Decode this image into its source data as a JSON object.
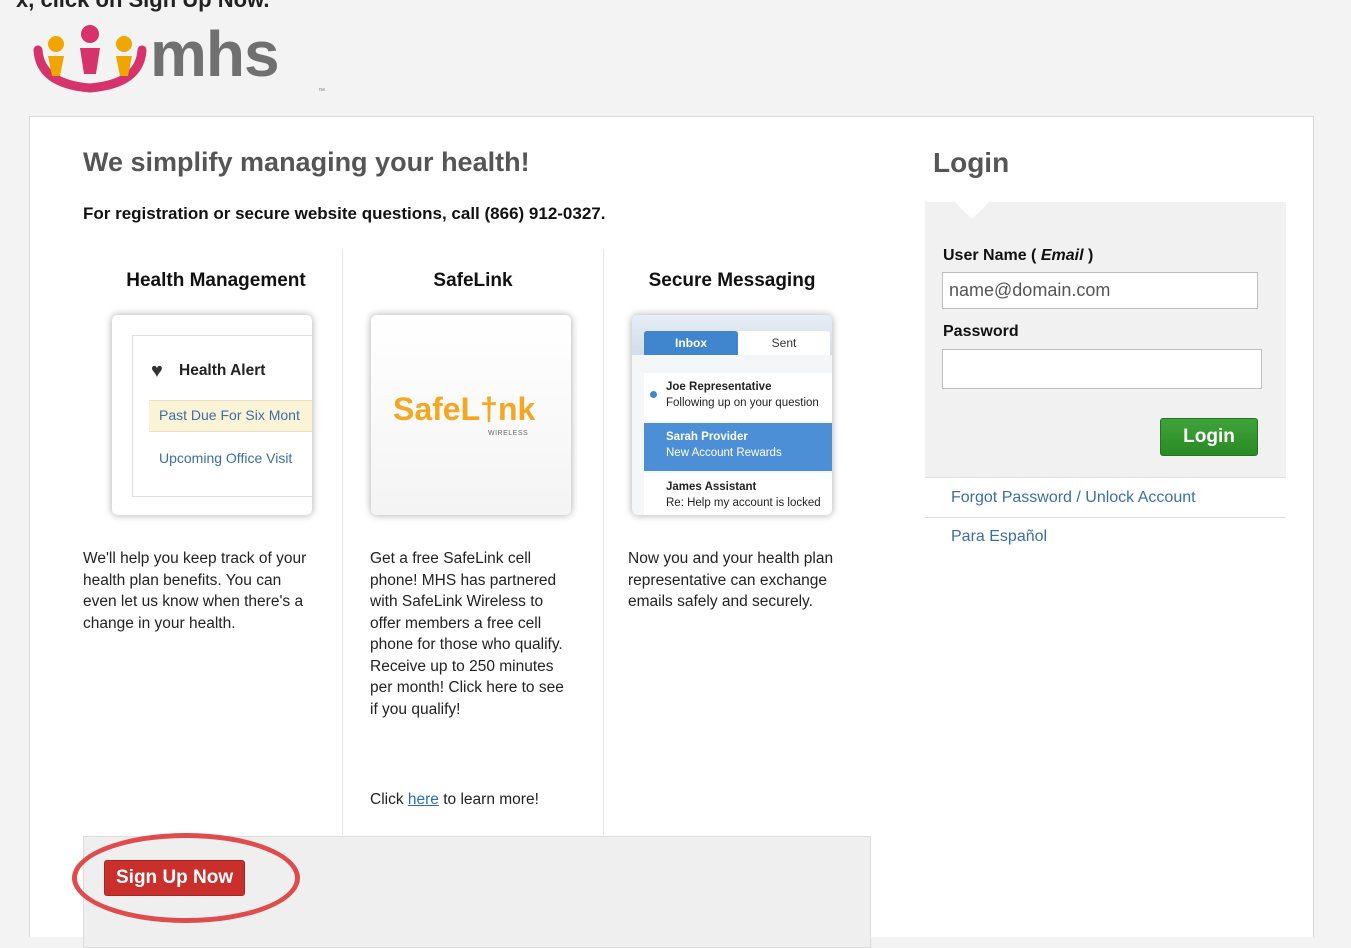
{
  "top_cut_text": "x, click on Sign Up Now.",
  "logo": {
    "text": "mhs",
    "tm": "™"
  },
  "headline": "We simplify managing your health!",
  "phone_line": "For registration or secure website questions, call (866) 912-0327.",
  "features": {
    "health": {
      "title": "Health Management",
      "card": {
        "alert_title": "Health Alert",
        "line1": "Past Due For Six Mont",
        "line2": "Upcoming Office Visit"
      },
      "text": "We'll help you keep track of your health plan benefits. You can even let us know when there's a change in your health."
    },
    "safelink": {
      "title": "SafeLink",
      "card": {
        "logo_text": "SafeL†nk",
        "logo_sub": "WIRELESS"
      },
      "text": "Get a free SafeLink cell phone! MHS has partnered with SafeLink Wireless to offer members a free cell phone for those who qualify. Receive up to 250 minutes per month! Click here to see if you qualify!",
      "learn_more_prefix": "Click",
      "learn_more_link": "here",
      "learn_more_suffix": "to learn more!"
    },
    "secure": {
      "title": "Secure Messaging",
      "card": {
        "tab_inbox": "Inbox",
        "tab_sent": "Sent",
        "messages": [
          {
            "from": "Joe Representative",
            "subject": "Following up on your question"
          },
          {
            "from": "Sarah Provider",
            "subject": "New Account Rewards"
          },
          {
            "from": "James Assistant",
            "subject": "Re: Help my account is locked"
          }
        ]
      },
      "text": "Now you and your health plan representative can exchange emails safely and securely."
    }
  },
  "signup": {
    "button_label": "Sign Up Now"
  },
  "login": {
    "title": "Login",
    "username_label": "User Name",
    "username_hint": "Email",
    "username_placeholder": "name@domain.com",
    "password_label": "Password",
    "button_label": "Login",
    "forgot_link": "Forgot Password / Unlock Account",
    "spanish_link": "Para Español"
  },
  "colors": {
    "signup_red": "#c9302c",
    "login_green": "#2f9a2a",
    "link_blue": "#3b6ea8",
    "annotation_circle": "#e04b4b"
  }
}
